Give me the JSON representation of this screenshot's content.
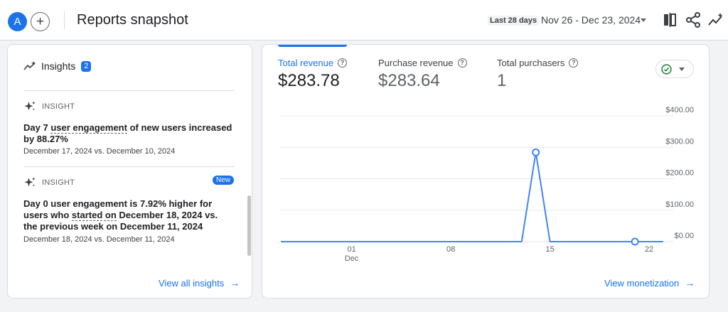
{
  "header": {
    "avatar_letter": "A",
    "title": "Reports snapshot",
    "date_chip": "Last 28 days",
    "date_range": "Nov 26 - Dec 23, 2024",
    "icons": [
      "compare-icon",
      "share-icon",
      "insights-icon"
    ]
  },
  "insights": {
    "title": "Insights",
    "count": "2",
    "items": [
      {
        "label": "INSIGHT",
        "text_pre": "Day 7 ",
        "text_underlined": "user engagement",
        "text_post": " of new users increased by 88.27%",
        "date": "December 17, 2024 vs. December 10, 2024"
      },
      {
        "label": "INSIGHT",
        "badge": "New",
        "text_pre": "Day 0 user engagement is 7.92% higher for users who ",
        "text_underlined": "started on",
        "text_post": " December 18, 2024 vs. the previous week on December 11, 2024",
        "date": "December 18, 2024 vs. December 11, 2024"
      }
    ],
    "view_all_label": "View all insights"
  },
  "revenue": {
    "metrics": [
      {
        "label": "Total revenue",
        "value": "$283.78"
      },
      {
        "label": "Purchase revenue",
        "value": "$283.64"
      },
      {
        "label": "Total purchasers",
        "value": "1"
      }
    ],
    "status_icon": "check-circle-icon",
    "view_link": "View monetization",
    "accent_color": "#1a73e8"
  },
  "chart_data": {
    "type": "line",
    "x_ticks": [
      "01",
      "08",
      "15",
      "22"
    ],
    "x_subtick": "Dec",
    "y_ticks": [
      "$400.00",
      "$300.00",
      "$200.00",
      "$100.00",
      "$0.00"
    ],
    "ylim": [
      0,
      400
    ],
    "x": [
      "Nov 26",
      "Nov 27",
      "Nov 28",
      "Nov 29",
      "Nov 30",
      "Dec 1",
      "Dec 2",
      "Dec 3",
      "Dec 4",
      "Dec 5",
      "Dec 6",
      "Dec 7",
      "Dec 8",
      "Dec 9",
      "Dec 10",
      "Dec 11",
      "Dec 12",
      "Dec 13",
      "Dec 14",
      "Dec 15",
      "Dec 16",
      "Dec 17",
      "Dec 18",
      "Dec 19",
      "Dec 20",
      "Dec 21",
      "Dec 22",
      "Dec 23"
    ],
    "series": [
      {
        "values": [
          0,
          0,
          0,
          0,
          0,
          0,
          0,
          0,
          0,
          0,
          0,
          0,
          0,
          0,
          0,
          0,
          0,
          0,
          283.78,
          0,
          0,
          0,
          0,
          0,
          0,
          0,
          0,
          0
        ],
        "markers": [
          18,
          25
        ]
      }
    ]
  }
}
